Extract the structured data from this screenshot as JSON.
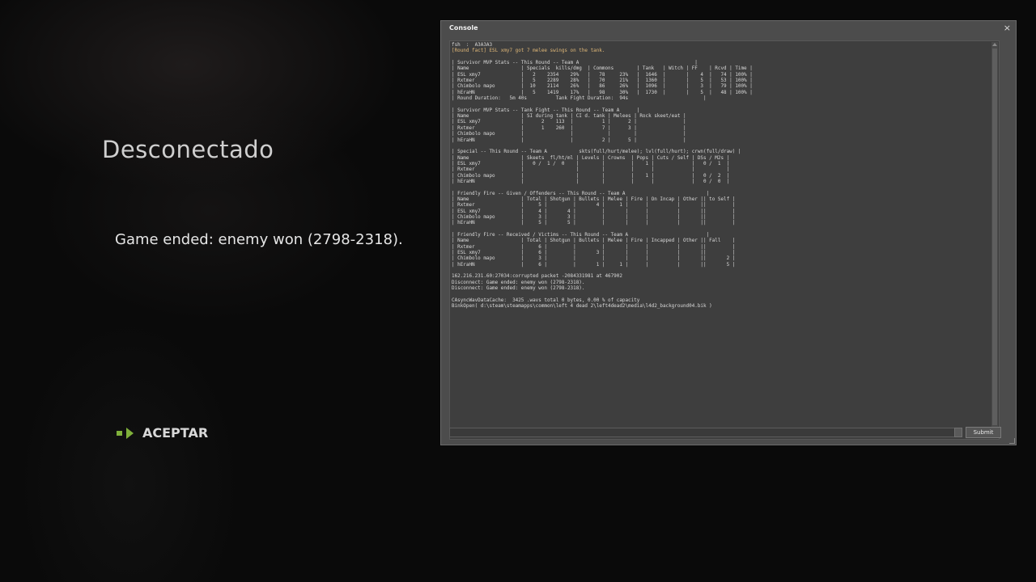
{
  "dialog": {
    "title": "Desconectado",
    "message": "Game ended: enemy won (2798-2318).",
    "accept_label": "ACEPTAR"
  },
  "console": {
    "title": "Console",
    "close_glyph": "×",
    "submit_label": "Submit",
    "input_value": "",
    "fact_line": "[Round fact] ESL xmy7 got 7 melee swings on the tank.",
    "log_top": "fsh  :  A3A3A3",
    "log_lines": [
      "",
      "| Survivor MVP Stats -- This Round -- Team A                                        |",
      "| Name                  | Specials  kills/dmg  | Commons        | Tank   | Witch | FF    | Rcvd | Time |",
      "| ESL xmy7              |   2    2354    29%   |   78     23%   |  1646  |       |    4  |   74 | 100% |",
      "| Rxtmer                |   5    2289    28%   |   70     21%   |  1360  |       |    5  |   53 | 100% |",
      "| Chimbolo mapo         |  10    2114    26%   |   86     26%   |  1096  |       |    3  |   79 | 100% |",
      "| hEraHN                |   5    1419    17%   |   98     30%   |  1730  |       |    5  |   48 | 100% |",
      "| Round Duration:   5m 40s          Tank Fight Duration:  94s                          |",
      "",
      "| Survivor MVP Stats -- Tank Fight -- This Round -- Team A      |",
      "| Name                  | SI during tank | CI d. tank | Melees | Rock skeet/eat |",
      "| ESL xmy7              |      2    113  |          1 |      2 |                |",
      "| Rxtmer                |      1    260  |          7 |      3 |                |",
      "| Chimbolo mapo         |                |            |        |                |",
      "| hEraHN                |                |          2 |      5 |                |",
      "",
      "| Special -- This Round -- Team A           skts(full/hurt/melee); lvl(full/hurt); crwn(full/draw) |",
      "| Name                  | Skeets  fl/ht/ml | Levels | Crowns  | Pops | Cuts / Self | DSs / M2s |",
      "| ESL xmy7              |   0 /  1 /  0    |        |         |    1 |             |   0 /  1  |",
      "| Rxtmer                |                  |        |         |      |             |           |",
      "| Chimbolo mapo         |                  |        |         |    1 |             |   0 /  2  |",
      "| hEraHN                |                  |        |         |      |             |   0 /  0  |",
      "",
      "| Friendly Fire -- Given / Offenders -- This Round -- Team A                            |",
      "| Name                  | Total | Shotgun | Bullets | Melee | Fire | On Incap | Other || to Self |",
      "| Rxtmer                |     5 |         |       4 |     1 |      |          |       ||         |",
      "| ESL xmy7              |     4 |       4 |         |       |      |          |       ||         |",
      "| Chimbolo mapo         |     3 |       3 |         |       |      |          |       ||         |",
      "| hEraHN                |     5 |       5 |         |       |      |          |       ||         |",
      "",
      "| Friendly Fire -- Received / Victims -- This Round -- Team A                           |",
      "| Name                  | Total | Shotgun | Bullets | Melee | Fire | Incapped | Other || Fall    |",
      "| Rxtmer                |     6 |         |         |       |      |          |       ||         |",
      "| ESL xmy7              |     6 |         |       3 |       |      |          |       ||         |",
      "| Chimbolo mapo         |     3 |         |         |       |      |          |       ||       2 |",
      "| hEraHN                |     6 |         |       1 |     1 |      |          |       ||       5 |",
      "",
      "162.216.231.60:27034:corrupted packet -2084331981 at 467902",
      "Disconnect: Game ended: enemy won (2798-2318).",
      "Disconnect: Game ended: enemy won (2798-2318).",
      "",
      "CAsyncWavDataCache:  3425 .wavs total 0 bytes, 0.00 % of capacity",
      "BinkOpen( d:\\steam\\steamapps\\common\\left 4 dead 2\\left4dead2\\media\\l4d2_background04.bik )"
    ]
  }
}
